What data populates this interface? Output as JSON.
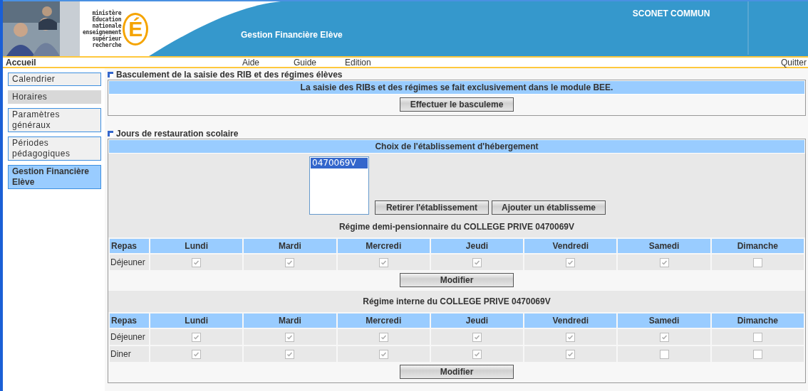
{
  "header": {
    "photo": {
      "kind": "picture"
    },
    "logo_lines": [
      "ministère",
      "Education",
      "nationale",
      "enseignement",
      "supérieur",
      "recherche"
    ],
    "logo_letter": "É",
    "title": "Gestion Financière Elève",
    "app_name": "SCONET COMMUN"
  },
  "nav": {
    "home": "Accueil",
    "items": [
      "Aide",
      "Guide",
      "Edition"
    ],
    "quit": "Quitter"
  },
  "sidebar": {
    "items": [
      {
        "label": "Calendrier",
        "disabled": false,
        "selected": false
      },
      {
        "label": "Horaires",
        "disabled": true,
        "selected": false
      },
      {
        "label": "Paramètres généraux",
        "disabled": false,
        "selected": false
      },
      {
        "label": "Périodes pédagogiques",
        "disabled": false,
        "selected": false
      },
      {
        "label": "Gestion Financière Elève",
        "disabled": false,
        "selected": true
      }
    ]
  },
  "notice": {
    "title": "Basculement de la saisie des RIB et des régimes élèves",
    "message": "La saisie des RIBs et des régimes se fait exclusivement dans le module BEE.",
    "button": "Effectuer le basculeme"
  },
  "meals": {
    "title": "Jours de restauration scolaire",
    "chooser_heading": "Choix de l'établissement d'hébergement",
    "options": [
      {
        "label": "0470069V",
        "selected": true
      }
    ],
    "remove_button": "Retirer l'établissement",
    "add_button": "Ajouter un établisseme",
    "regimes": [
      {
        "title": "Régime demi-pensionnaire du COLLEGE PRIVE 0470069V",
        "columns": [
          "Repas",
          "Lundi",
          "Mardi",
          "Mercredi",
          "Jeudi",
          "Vendredi",
          "Samedi",
          "Dimanche"
        ],
        "rows": [
          {
            "label": "Déjeuner",
            "days": [
              {
                "checked": true
              },
              {
                "checked": true
              },
              {
                "checked": true
              },
              {
                "checked": true
              },
              {
                "checked": true
              },
              {
                "checked": true
              },
              {
                "checked": false
              }
            ]
          }
        ],
        "button": "Modifier"
      },
      {
        "title": "Régime interne du COLLEGE PRIVE 0470069V",
        "columns": [
          "Repas",
          "Lundi",
          "Mardi",
          "Mercredi",
          "Jeudi",
          "Vendredi",
          "Samedi",
          "Dimanche"
        ],
        "rows": [
          {
            "label": "Déjeuner",
            "days": [
              {
                "checked": true
              },
              {
                "checked": true
              },
              {
                "checked": true
              },
              {
                "checked": true
              },
              {
                "checked": true
              },
              {
                "checked": true
              },
              {
                "checked": false
              }
            ]
          },
          {
            "label": "Diner",
            "days": [
              {
                "checked": true
              },
              {
                "checked": true
              },
              {
                "checked": true
              },
              {
                "checked": true
              },
              {
                "checked": true
              },
              {
                "checked": false
              },
              {
                "checked": false
              }
            ]
          }
        ],
        "button": "Modifier"
      }
    ]
  }
}
